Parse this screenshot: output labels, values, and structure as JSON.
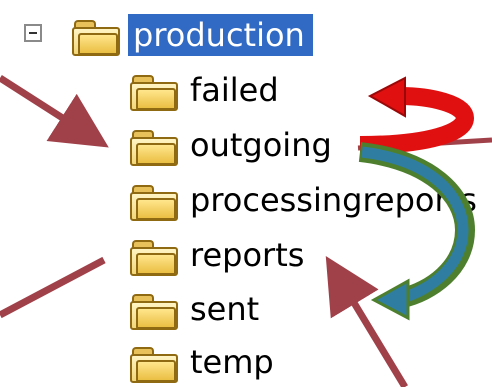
{
  "tree": {
    "root": {
      "label": "production",
      "expanded": true,
      "children": [
        {
          "label": "failed",
          "icon": "folder-icon"
        },
        {
          "label": "outgoing",
          "icon": "folder-icon"
        },
        {
          "label": "processingreports",
          "icon": "folder-icon"
        },
        {
          "label": "reports",
          "icon": "folder-icon"
        },
        {
          "label": "sent",
          "icon": "folder-icon"
        },
        {
          "label": "temp",
          "icon": "folder-icon"
        }
      ]
    }
  },
  "colors": {
    "selection": "#316ac5",
    "annotation_arrow": "#a0414a",
    "red_arrow": "#e01010",
    "green_arrow": "#4d7f2e",
    "teal_arrow": "#2f7ea1"
  }
}
